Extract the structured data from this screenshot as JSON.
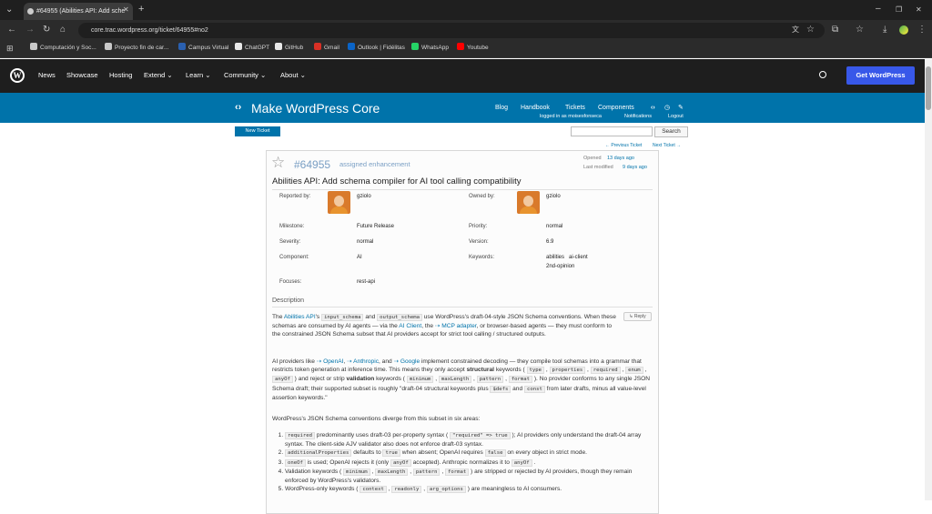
{
  "browser": {
    "tab_title": "#64955 (Abilities API: Add sche",
    "url": "core.trac.wordpress.org/ticket/64955#no2",
    "bookmarks": [
      {
        "label": "Computación y Soc...",
        "icon": "folder-icon",
        "color": "#c8c8c8"
      },
      {
        "label": "Proyecto fin de car...",
        "icon": "folder-icon",
        "color": "#c8c8c8"
      },
      {
        "label": "Campus Virtual",
        "icon": "campus-icon",
        "color": "#2a60b0"
      },
      {
        "label": "ChatGPT",
        "icon": "chatgpt-icon",
        "color": "#e8e8e8"
      },
      {
        "label": "GitHub",
        "icon": "github-icon",
        "color": "#e8e8e8"
      },
      {
        "label": "Gmail",
        "icon": "gmail-icon",
        "color": "#d93025"
      },
      {
        "label": "Outlook | Fidélitas",
        "icon": "outlook-icon",
        "color": "#0a64c8"
      },
      {
        "label": "WhatsApp",
        "icon": "whatsapp-icon",
        "color": "#25d366"
      },
      {
        "label": "Youtube",
        "icon": "youtube-icon",
        "color": "#ff0000"
      }
    ]
  },
  "wpnav": {
    "items": [
      "News",
      "Showcase",
      "Hosting",
      "Extend ⌄",
      "Learn ⌄",
      "Community ⌄",
      "About ⌄"
    ],
    "cta": "Get WordPress"
  },
  "make": {
    "title": "Make WordPress Core",
    "links": [
      "Blog",
      "Handbook",
      "Tickets",
      "Components"
    ],
    "logged_in": "logged in as moisesfonseca",
    "notifications": "Notifications",
    "logout": "Logout"
  },
  "trac": {
    "new_ticket": "New Ticket",
    "search_btn": "Search",
    "prev": "← Previous Ticket",
    "next": "Next Ticket →"
  },
  "ticket": {
    "number": "#64955",
    "status": "assigned enhancement",
    "opened_label": "Opened",
    "opened_ago": "13 days ago",
    "modified_label": "Last modified",
    "modified_ago": "9 days ago",
    "title": "Abilities API: Add schema compiler for AI tool calling compatibility",
    "reported_by_label": "Reported by:",
    "reported_by": "gziolo",
    "owned_by_label": "Owned by:",
    "owned_by": "gziolo",
    "milestone_label": "Milestone:",
    "milestone": "Future Release",
    "priority_label": "Priority:",
    "priority": "normal",
    "severity_label": "Severity:",
    "severity": "normal",
    "version_label": "Version:",
    "version": "6.9",
    "component_label": "Component:",
    "component": "AI",
    "keywords_label": "Keywords:",
    "keywords_1": "abilities   ai-client",
    "keywords_2": "2nd-opinion",
    "focuses_label": "Focuses:",
    "focuses": "rest-api",
    "description_label": "Description",
    "reply": "↳ Reply"
  }
}
